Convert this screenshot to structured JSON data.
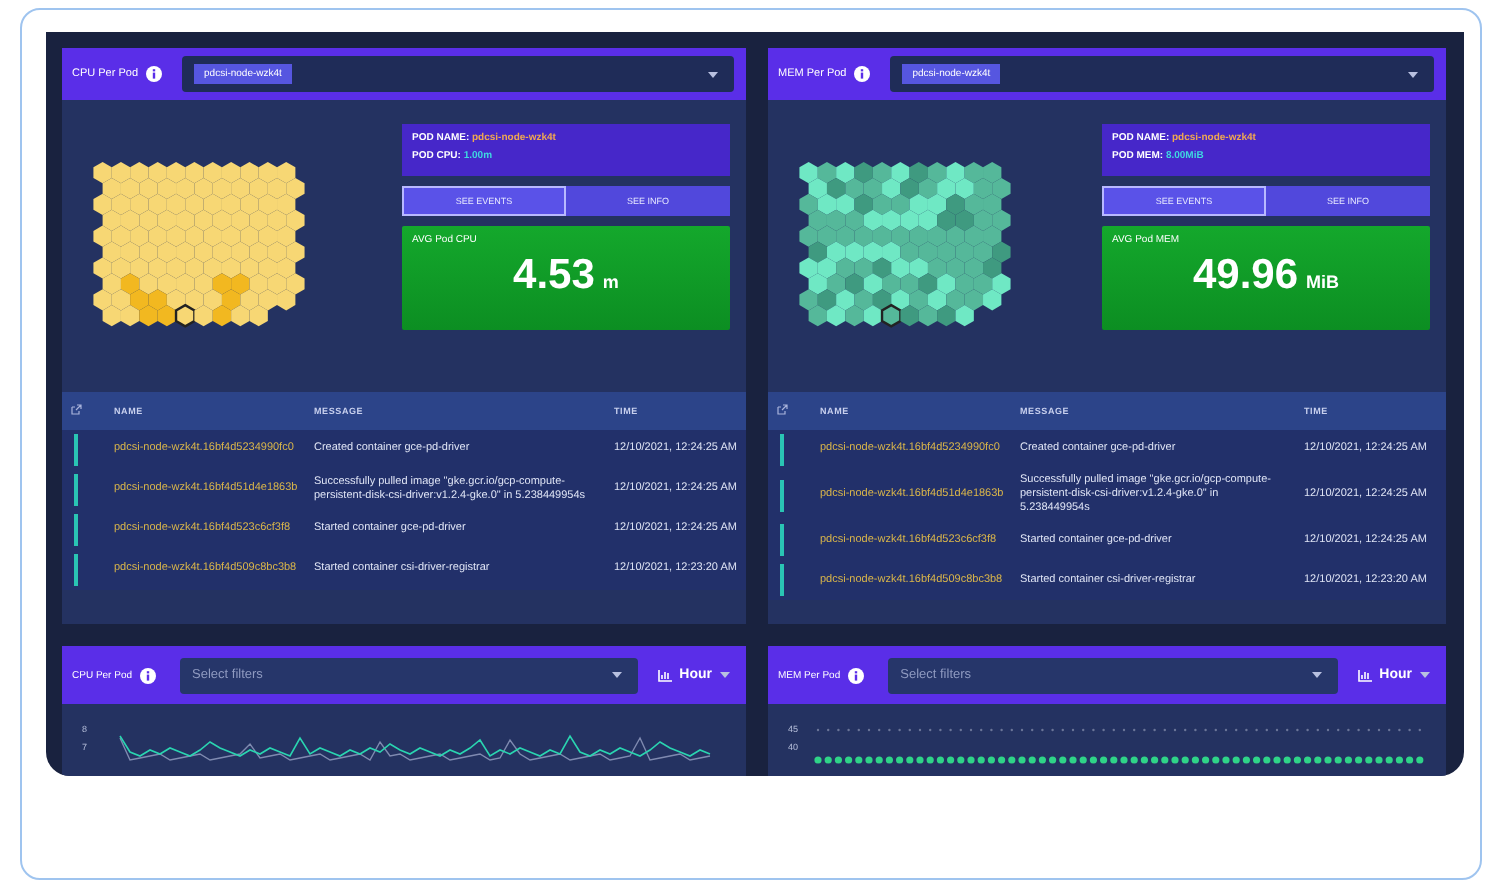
{
  "panels": [
    {
      "kind": "cpu",
      "title": "CPU Per Pod",
      "selected_pod": "pdcsi-node-wzk4t",
      "pod_name_label": "POD NAME:",
      "pod_name": "pdcsi-node-wzk4t",
      "metric_label": "POD CPU:",
      "metric_value": "1.00m",
      "buttons": [
        {
          "label": "SEE EVENTS",
          "selected": true
        },
        {
          "label": "SEE INFO",
          "selected": false
        }
      ],
      "avg_label": "AVG Pod CPU",
      "avg_value": "4.53",
      "avg_unit": "m",
      "table": {
        "columns": [
          "NAME",
          "MESSAGE",
          "TIME"
        ],
        "rows": [
          {
            "name": "pdcsi-node-wzk4t.16bf4d5234990fc0",
            "message": "Created container gce-pd-driver",
            "time": "12/10/2021, 12:24:25 AM"
          },
          {
            "name": "pdcsi-node-wzk4t.16bf4d51d4e1863b",
            "message": "Successfully pulled image \"gke.gcr.io/gcp-compute-persistent-disk-csi-driver:v1.2.4-gke.0\" in 5.238449954s",
            "time": "12/10/2021, 12:24:25 AM"
          },
          {
            "name": "pdcsi-node-wzk4t.16bf4d523c6cf3f8",
            "message": "Started container gce-pd-driver",
            "time": "12/10/2021, 12:24:25 AM"
          },
          {
            "name": "pdcsi-node-wzk4t.16bf4d509c8bc3b8",
            "message": "Started container csi-driver-registrar",
            "time": "12/10/2021, 12:23:20 AM"
          }
        ]
      }
    },
    {
      "kind": "mem",
      "title": "MEM Per Pod",
      "selected_pod": "pdcsi-node-wzk4t",
      "pod_name_label": "POD NAME:",
      "pod_name": "pdcsi-node-wzk4t",
      "metric_label": "POD MEM:",
      "metric_value": "8.00MiB",
      "buttons": [
        {
          "label": "SEE EVENTS",
          "selected": true
        },
        {
          "label": "SEE INFO",
          "selected": false
        }
      ],
      "avg_label": "AVG Pod MEM",
      "avg_value": "49.96",
      "avg_unit": "MiB",
      "table": {
        "columns": [
          "NAME",
          "MESSAGE",
          "TIME"
        ],
        "rows": [
          {
            "name": "pdcsi-node-wzk4t.16bf4d5234990fc0",
            "message": "Created container gce-pd-driver",
            "time": "12/10/2021, 12:24:25 AM"
          },
          {
            "name": "pdcsi-node-wzk4t.16bf4d51d4e1863b",
            "message": "Successfully pulled image \"gke.gcr.io/gcp-compute-persistent-disk-csi-driver:v1.2.4-gke.0\" in 5.238449954s",
            "time": "12/10/2021, 12:24:25 AM"
          },
          {
            "name": "pdcsi-node-wzk4t.16bf4d523c6cf3f8",
            "message": "Started container gce-pd-driver",
            "time": "12/10/2021, 12:24:25 AM"
          },
          {
            "name": "pdcsi-node-wzk4t.16bf4d509c8bc3b8",
            "message": "Started container csi-driver-registrar",
            "time": "12/10/2021, 12:23:20 AM"
          }
        ]
      }
    }
  ],
  "charts": [
    {
      "kind": "line",
      "title": "CPU Per Pod",
      "filter_placeholder": "Select filters",
      "interval": "Hour",
      "y_ticks": [
        "8",
        "7"
      ]
    },
    {
      "kind": "dots",
      "title": "MEM Per Pod",
      "filter_placeholder": "Select filters",
      "interval": "Hour",
      "y_ticks": [
        "45",
        "40"
      ]
    }
  ]
}
